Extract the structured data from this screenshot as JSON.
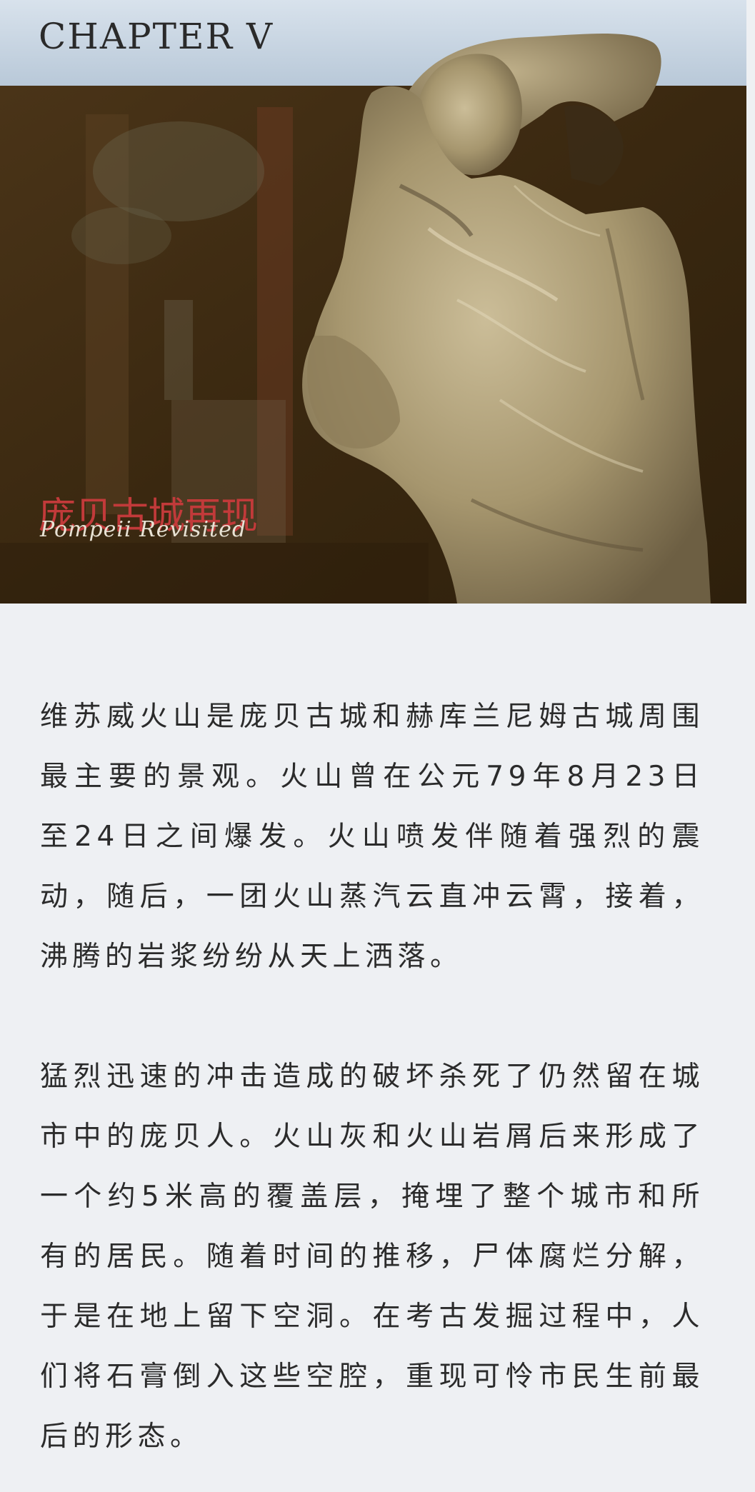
{
  "hero": {
    "chapter_title": "CHAPTER V",
    "film_title": "庞贝古城再现",
    "film_subtitle": "Pompeii Revisited",
    "image_subject": "plaster-cast-torso"
  },
  "article": {
    "paragraphs": [
      "维苏威火山是庞贝古城和赫库兰尼姆古城周围最主要的景观。火山曾在公元79年8月23日至24日之间爆发。火山喷发伴随着强烈的震动，随后，一团火山蒸汽云直冲云霄，接着，沸腾的岩浆纷纷从天上洒落。",
      "猛烈迅速的冲击造成的破坏杀死了仍然留在城市中的庞贝人。火山灰和火山岩屑后来形成了一个约5米高的覆盖层，掩埋了整个城市和所有的居民。随着时间的推移，尸体腐烂分解，于是在地上留下空洞。在考古发掘过程中，人们将石膏倒入这些空腔，重现可怜市民生前最后的形态。"
    ]
  },
  "colors": {
    "page_background": "#eef0f3",
    "sky": "#c9d6e2",
    "fresco_dark": "#3e2c14",
    "title_red": "#c23a3a",
    "body_text": "#2b2b2b"
  }
}
